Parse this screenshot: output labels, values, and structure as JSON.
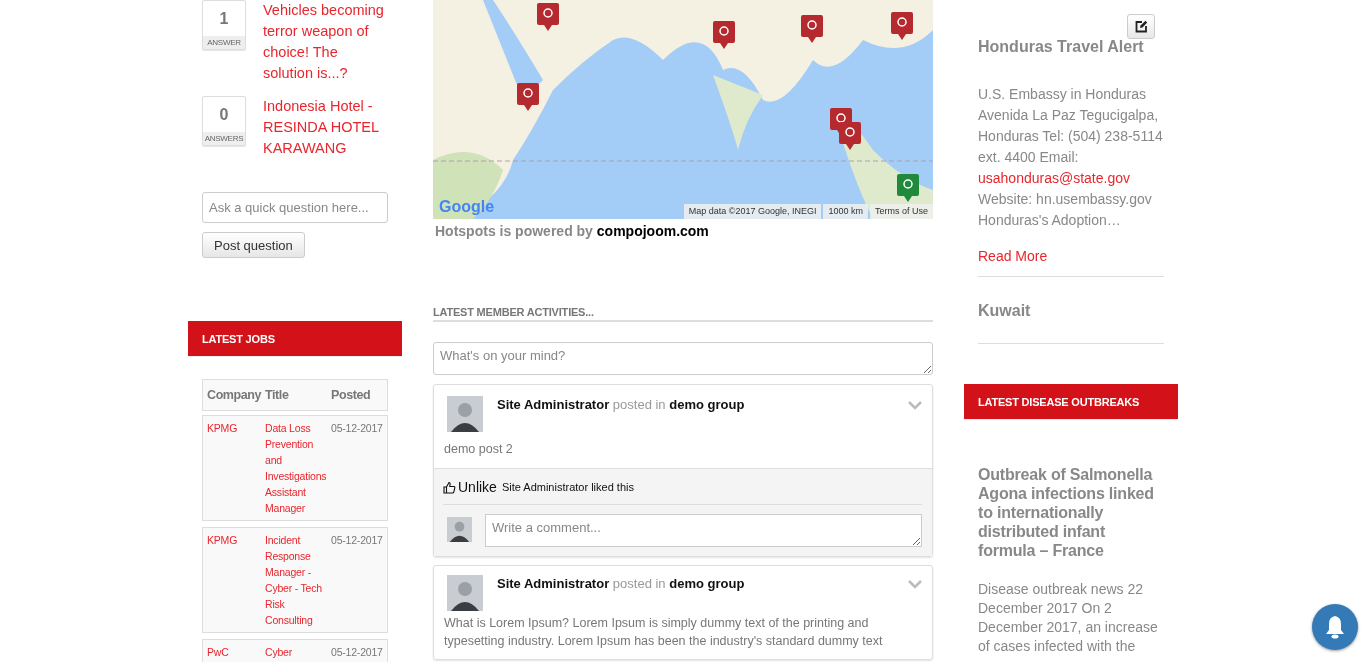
{
  "questions": {
    "items": [
      {
        "count": "1",
        "count_label": "ANSWER",
        "title": "Vehicles becoming terror weapon of choice! The solution is...?"
      },
      {
        "count": "0",
        "count_label": "ANSWERS",
        "title": "Indonesia Hotel - RESINDA HOTEL KARAWANG"
      }
    ],
    "input": {
      "placeholder": "Ask a quick question here..."
    },
    "button": "Post question"
  },
  "jobs": {
    "title": "LATEST JOBS",
    "columns": [
      "Company",
      "Title",
      "Posted"
    ],
    "rows": [
      {
        "company": "KPMG",
        "title": "Data Loss Prevention and Investigations Assistant Manager",
        "posted": "05-12-2017"
      },
      {
        "company": "KPMG",
        "title": "Incident Response Manager - Cyber - Tech Risk Consulting",
        "posted": "05-12-2017"
      },
      {
        "company": "PwC",
        "title": "Cyber",
        "posted": "05-12-2017"
      }
    ]
  },
  "map": {
    "logo": "Google",
    "attribution": "Map data ©2017 Google, INEGI",
    "scale": "1000 km",
    "terms": "Terms of Use",
    "powered_by": "Hotspots is powered by",
    "powered_link": "compojoom.com"
  },
  "activities": {
    "title": "LATEST MEMBER ACTIVITIES...",
    "composer": {
      "placeholder": "What's on your mind?"
    },
    "posts": [
      {
        "author": "Site Administrator",
        "connector": "posted in",
        "group": "demo group",
        "body": "demo post 2",
        "like": {
          "action": "Unlike",
          "summary": "Site Administrator liked this"
        },
        "comment": {
          "placeholder": "Write a comment..."
        }
      },
      {
        "author": "Site Administrator",
        "connector": "posted in",
        "group": "demo group",
        "body": "What is Lorem Ipsum? Lorem Ipsum is simply dummy text of the printing and typesetting industry. Lorem Ipsum has been the industry's standard dummy text"
      }
    ]
  },
  "alert": {
    "title": "Honduras Travel Alert",
    "body_before": "U.S. Embassy in Honduras Avenida La Paz Tegucigalpa, Honduras Tel: (504) 238-5114 ext. 4400 Email:",
    "email": "usahonduras@state.gov",
    "body_after": "Website: hn.usembassy.gov Honduras's Adoption…",
    "read_more": "Read More",
    "next_title": "Kuwait"
  },
  "outbreaks": {
    "title": "LATEST DISEASE OUTBREAKS",
    "headline": "Outbreak of Salmonella Agona infections linked to internationally distributed infant formula – France",
    "summary": "Disease outbreak news 22 December 2017 On 2 December 2017, an increase of cases infected with the"
  }
}
